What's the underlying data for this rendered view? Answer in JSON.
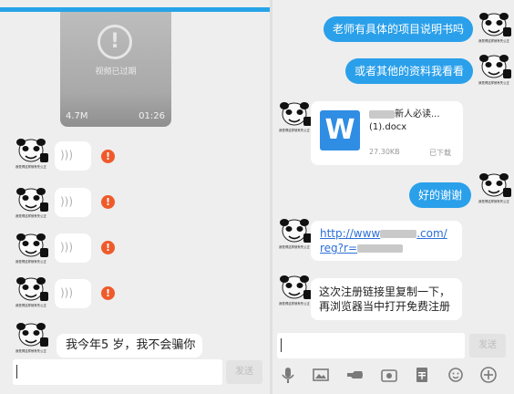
{
  "left": {
    "video": {
      "expired_label": "视频已过期",
      "size": "4.7M",
      "duration": "01:26"
    },
    "voice_waves": ")))",
    "error_mark": "!",
    "avatar_caption": "我觉得这样就有失公正",
    "last_message": "我今年5  岁，我不会骗你",
    "send_label": "发送"
  },
  "right": {
    "messages_sent": [
      "老师有具体的项目说明书吗",
      "或者其他的资料我看看",
      "好的谢谢"
    ],
    "file": {
      "icon": "W",
      "name_line1": "新人必读...",
      "name_line2": "(1).docx",
      "size": "27.30KB",
      "status": "已下载"
    },
    "link": {
      "line1_a": "http://www",
      "line1_b": ".com/",
      "line2": "reg?r="
    },
    "instruction": "这次注册链接里复制一下，再浏览器当中打开免费注册",
    "send_label": "发送",
    "toolbar_icons": [
      "microphone-icon",
      "image-icon",
      "hand-icon",
      "camera-icon",
      "red-packet-icon",
      "emoji-icon",
      "plus-icon"
    ]
  },
  "colors": {
    "accent_blue": "#2ba0ea",
    "error_red": "#ef5a2a",
    "word_blue": "#2f8de4"
  }
}
